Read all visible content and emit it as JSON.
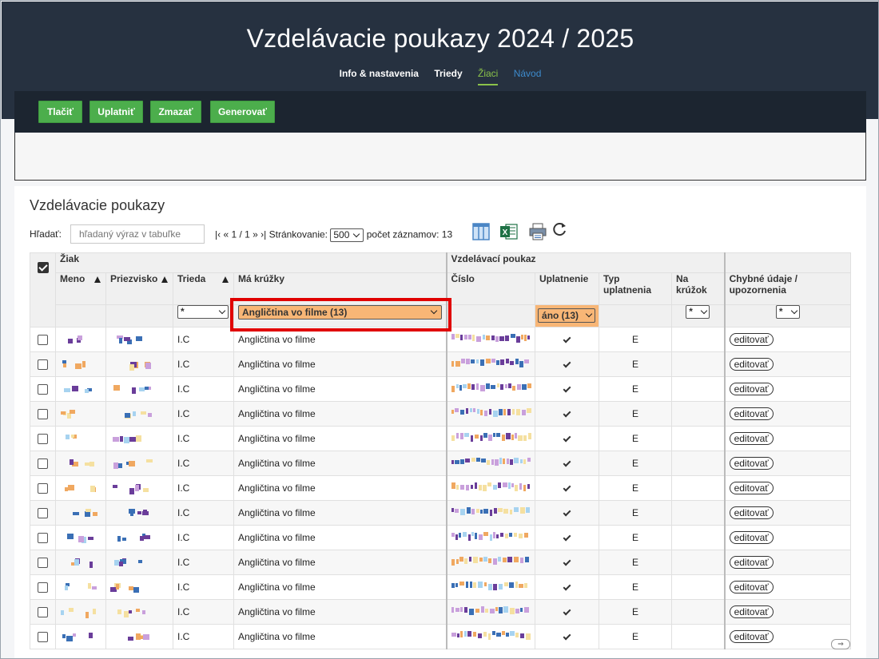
{
  "app": {
    "title": "Vzdelávacie poukazy 2024 / 2025",
    "nav": [
      "Info & nastavenia",
      "Triedy",
      "Žiaci",
      "Návod"
    ],
    "active_nav": "Žiaci"
  },
  "toolbar": {
    "buttons": [
      "Tlačiť",
      "Uplatniť",
      "Zmazať",
      "Generovať"
    ],
    "button_color": "#4cae4c"
  },
  "section": {
    "title": "Vzdelávacie poukazy",
    "search_label": "Hľadať:",
    "search_placeholder": "hľadaný výraz v tabuľke",
    "pager_text": "|‹ « 1 / 1 » ›|",
    "paging_label": "Stránkovanie:",
    "page_size": "500",
    "record_count": "počet záznamov: 13",
    "icons": [
      "columns-icon",
      "excel-icon",
      "print-icon",
      "refresh-icon"
    ]
  },
  "table": {
    "group_headers": [
      "Žiak",
      "Vzdelávací poukaz"
    ],
    "columns": {
      "meno": "Meno",
      "priezvisko": "Priezvisko",
      "trieda": "Trieda",
      "ma_kruzky": "Má krúžky",
      "cislo": "Číslo",
      "uplatnenie": "Uplatnenie",
      "typ_uplatnenia": "Typ uplatnenia",
      "na_kruzok": "Na krúžok",
      "chybne": "Chybné údaje / upozornenia"
    },
    "filters": {
      "trieda": "*",
      "ma_kruzky": "Angličtina vo filme (13)",
      "uplatnenie": "áno (13)",
      "na_kruzok": "*",
      "chybne": "*",
      "active_color": "#f8b676",
      "highlight_color": "#e00000"
    },
    "rows": [
      {
        "trieda": "I.C",
        "kruzok": "Angličtina vo filme",
        "typ": "E",
        "edit": "editovať"
      },
      {
        "trieda": "I.C",
        "kruzok": "Angličtina vo filme",
        "typ": "E",
        "edit": "editovať"
      },
      {
        "trieda": "I.C",
        "kruzok": "Angličtina vo filme",
        "typ": "E",
        "edit": "editovať"
      },
      {
        "trieda": "I.C",
        "kruzok": "Angličtina vo filme",
        "typ": "E",
        "edit": "editovať"
      },
      {
        "trieda": "I.C",
        "kruzok": "Angličtina vo filme",
        "typ": "E",
        "edit": "editovať"
      },
      {
        "trieda": "I.C",
        "kruzok": "Angličtina vo filme",
        "typ": "E",
        "edit": "editovať"
      },
      {
        "trieda": "I.C",
        "kruzok": "Angličtina vo filme",
        "typ": "E",
        "edit": "editovať"
      },
      {
        "trieda": "I.C",
        "kruzok": "Angličtina vo filme",
        "typ": "E",
        "edit": "editovať"
      },
      {
        "trieda": "I.C",
        "kruzok": "Angličtina vo filme",
        "typ": "E",
        "edit": "editovať"
      },
      {
        "trieda": "I.C",
        "kruzok": "Angličtina vo filme",
        "typ": "E",
        "edit": "editovať"
      },
      {
        "trieda": "I.C",
        "kruzok": "Angličtina vo filme",
        "typ": "E",
        "edit": "editovať"
      },
      {
        "trieda": "I.C",
        "kruzok": "Angličtina vo filme",
        "typ": "E",
        "edit": "editovať"
      },
      {
        "trieda": "I.C",
        "kruzok": "Angličtina vo filme",
        "typ": "E",
        "edit": "editovať"
      }
    ],
    "redaction_colors": [
      "#6a3d9a",
      "#3a6fb5",
      "#f0a860",
      "#a7d3f0",
      "#f5e0a0",
      "#c9a0dc"
    ]
  }
}
